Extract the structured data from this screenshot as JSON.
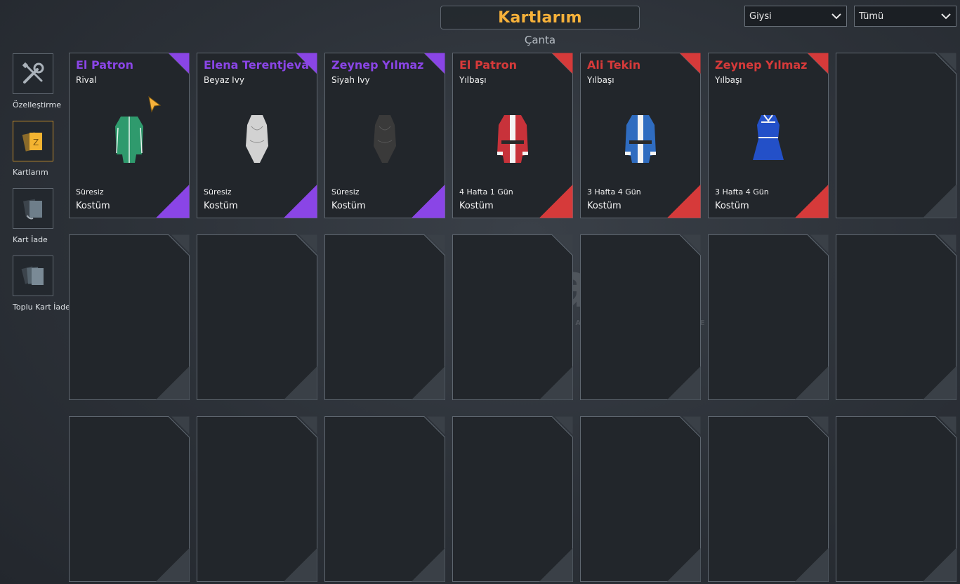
{
  "header": {
    "title": "Kartlarım",
    "subtitle": "Çanta"
  },
  "filters": {
    "category": "Giysi",
    "scope": "Tümü"
  },
  "sidebar": {
    "items": [
      {
        "label": "Özelleştirme",
        "icon": "tools-icon"
      },
      {
        "label": "Kartlarım",
        "icon": "cards-icon",
        "active": true
      },
      {
        "label": "Kart İade",
        "icon": "card-return-icon"
      },
      {
        "label": "Toplu Kart İade",
        "icon": "bulk-card-return-icon"
      }
    ]
  },
  "cards": [
    {
      "name": "El Patron",
      "subtitle": "Rival",
      "duration": "Süresiz",
      "type": "Kostüm",
      "rarity_color": "#8a45e6",
      "item": "green-tracksuit"
    },
    {
      "name": "Elena Terentjeva",
      "subtitle": "Beyaz Ivy",
      "duration": "Süresiz",
      "type": "Kostüm",
      "rarity_color": "#8a45e6",
      "item": "white-bodysuit"
    },
    {
      "name": "Zeynep Yılmaz",
      "subtitle": "Siyah Ivy",
      "duration": "Süresiz",
      "type": "Kostüm",
      "rarity_color": "#8a45e6",
      "item": "black-bodysuit"
    },
    {
      "name": "El Patron",
      "subtitle": "Yılbaşı",
      "duration": "4 Hafta 1 Gün",
      "type": "Kostüm",
      "rarity_color": "#d63a3a",
      "item": "red-santa-coat"
    },
    {
      "name": "Ali Tekin",
      "subtitle": "Yılbaşı",
      "duration": "3 Hafta 4 Gün",
      "type": "Kostüm",
      "rarity_color": "#d63a3a",
      "item": "blue-santa-coat"
    },
    {
      "name": "Zeynep Yılmaz",
      "subtitle": "Yılbaşı",
      "duration": "3 Hafta 4 Gün",
      "type": "Kostüm",
      "rarity_color": "#d63a3a",
      "item": "blue-dress"
    }
  ],
  "watermark": {
    "brand": "itemsatış",
    "tagline": "HESAP / SKIN / ITEM / E-PIN",
    "suffix": ".com"
  },
  "colors": {
    "accent": "#f6b13a",
    "epic": "#8a45e6",
    "legendary": "#d63a3a"
  }
}
